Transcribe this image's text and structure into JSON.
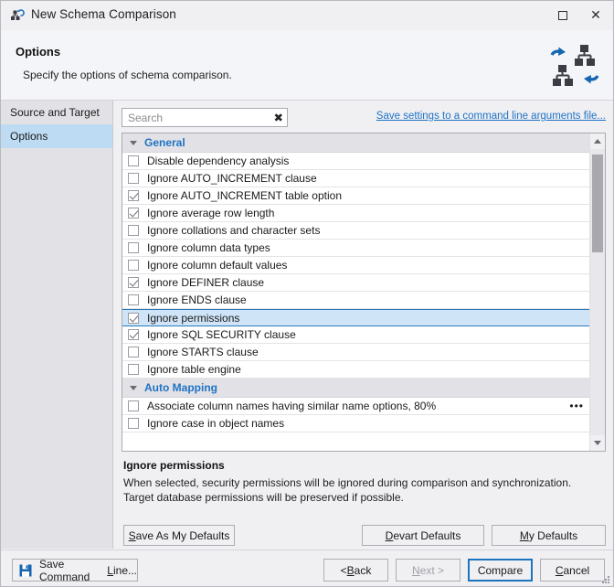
{
  "window": {
    "title": "New Schema Comparison",
    "app_icon": "schema-compare-icon",
    "maximize_label": "Maximize",
    "close_label": "Close"
  },
  "header": {
    "title": "Options",
    "subtitle": "Specify the options of schema comparison.",
    "art_icon": "schema-sync-icon"
  },
  "sidebar": {
    "items": [
      {
        "label": "Source and Target",
        "selected": false
      },
      {
        "label": "Options",
        "selected": true
      }
    ]
  },
  "search": {
    "value": "",
    "placeholder": "Search",
    "clear_glyph": "✖"
  },
  "command_line_link": "Save settings to a command line arguments file...",
  "options_list": {
    "groups": [
      {
        "name": "General",
        "expanded": true,
        "options": [
          {
            "label": "Disable dependency analysis",
            "checked": false,
            "selected": false,
            "has_ellipsis": false
          },
          {
            "label": "Ignore AUTO_INCREMENT clause",
            "checked": false,
            "selected": false,
            "has_ellipsis": false
          },
          {
            "label": "Ignore AUTO_INCREMENT table option",
            "checked": true,
            "selected": false,
            "has_ellipsis": false
          },
          {
            "label": "Ignore average row length",
            "checked": true,
            "selected": false,
            "has_ellipsis": false
          },
          {
            "label": "Ignore collations and character sets",
            "checked": false,
            "selected": false,
            "has_ellipsis": false
          },
          {
            "label": "Ignore column data types",
            "checked": false,
            "selected": false,
            "has_ellipsis": false
          },
          {
            "label": "Ignore column default values",
            "checked": false,
            "selected": false,
            "has_ellipsis": false
          },
          {
            "label": "Ignore DEFINER clause",
            "checked": true,
            "selected": false,
            "has_ellipsis": false
          },
          {
            "label": "Ignore ENDS clause",
            "checked": false,
            "selected": false,
            "has_ellipsis": false
          },
          {
            "label": "Ignore permissions",
            "checked": true,
            "selected": true,
            "has_ellipsis": false
          },
          {
            "label": "Ignore SQL SECURITY clause",
            "checked": true,
            "selected": false,
            "has_ellipsis": false
          },
          {
            "label": "Ignore STARTS clause",
            "checked": false,
            "selected": false,
            "has_ellipsis": false
          },
          {
            "label": "Ignore table engine",
            "checked": false,
            "selected": false,
            "has_ellipsis": false
          }
        ]
      },
      {
        "name": "Auto Mapping",
        "expanded": true,
        "options": [
          {
            "label": "Associate column names having similar name options, 80%",
            "checked": false,
            "selected": false,
            "has_ellipsis": true,
            "ellipsis_glyph": "•••"
          },
          {
            "label": "Ignore case in object names",
            "checked": false,
            "selected": false,
            "has_ellipsis": false
          }
        ]
      }
    ],
    "scrollbar": {
      "up_arrow": "scroll-up-icon",
      "down_arrow": "scroll-down-icon",
      "thumb_top_pct": 2,
      "thumb_height_pct": 34
    }
  },
  "description": {
    "title": "Ignore permissions",
    "body": "When selected, security permissions will be ignored during comparison and synchronization. Target database permissions will be preserved if possible."
  },
  "defaults_buttons": {
    "save_as_my_defaults": {
      "pre": "S",
      "post": "ave As My Defaults"
    },
    "devart_defaults": {
      "pre": "D",
      "post": "evart Defaults"
    },
    "my_defaults": {
      "pre": "M",
      "post": "y Defaults"
    }
  },
  "footer": {
    "save_command_line": {
      "pre": "Save Command ",
      "acc": "L",
      "post": "ine..."
    },
    "back": {
      "pre": "< ",
      "acc": "B",
      "post": "ack"
    },
    "next": {
      "acc": "N",
      "post": "ext >",
      "disabled": true
    },
    "compare": {
      "label": "Compare",
      "primary": true
    },
    "cancel": {
      "acc": "C",
      "post": "ancel"
    },
    "save_icon": "floppy-disk-icon",
    "resize_grip": "resize-grip-icon"
  },
  "colors": {
    "accent_link": "#1f72c4",
    "selection": "#cfe4f7",
    "selection_border": "#2a7ab9",
    "sidebar_selected": "#bddcf4",
    "group_header_bg": "#e2e2e6",
    "window_bg": "#f0f0f3",
    "primary_border": "#1e73be"
  }
}
